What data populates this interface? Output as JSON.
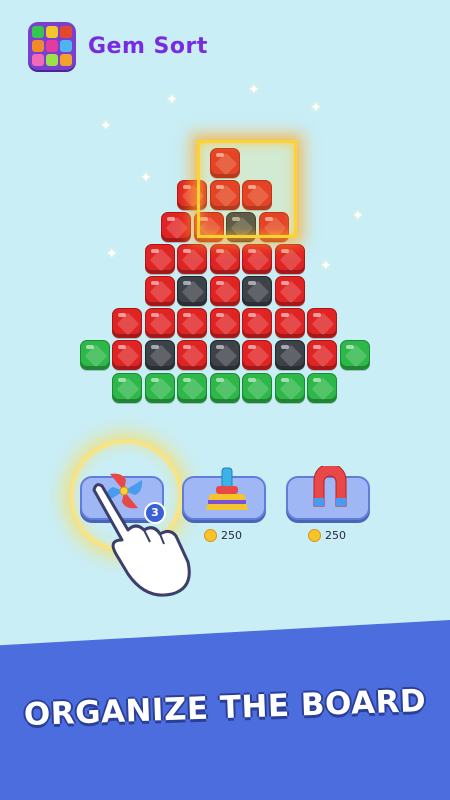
{
  "app": {
    "title": "Gem Sort",
    "logo_icon": "gem-grid-logo-icon"
  },
  "board": {
    "gem_colors": {
      "red": "#e02424",
      "black": "#3d4148",
      "green": "#2fb84a"
    },
    "rows": [
      [
        "red"
      ],
      [
        "red",
        "red",
        "red"
      ],
      [
        "red",
        "red",
        "black",
        "red"
      ],
      [
        "red",
        "red",
        "red",
        "red",
        "red"
      ],
      [
        "red",
        "black",
        "red",
        "black",
        "red"
      ],
      [
        "red",
        "red",
        "red",
        "red",
        "red",
        "red",
        "red"
      ],
      [
        "green",
        "red",
        "black",
        "red",
        "black",
        "red",
        "black",
        "red",
        "green"
      ],
      [
        "green",
        "green",
        "green",
        "green",
        "green",
        "green",
        "green"
      ]
    ],
    "selection_color": "#ffd234"
  },
  "powerups": [
    {
      "name": "fan",
      "icon": "pinwheel-icon",
      "count": "3"
    },
    {
      "name": "broom",
      "icon": "broom-icon",
      "price": "250"
    },
    {
      "name": "magnet",
      "icon": "magnet-icon",
      "price": "250"
    }
  ],
  "tutorial": {
    "pointer_icon": "pointing-hand-icon"
  },
  "banner": {
    "text": "ORGANIZE THE BOARD",
    "color": "#4c6dde"
  }
}
